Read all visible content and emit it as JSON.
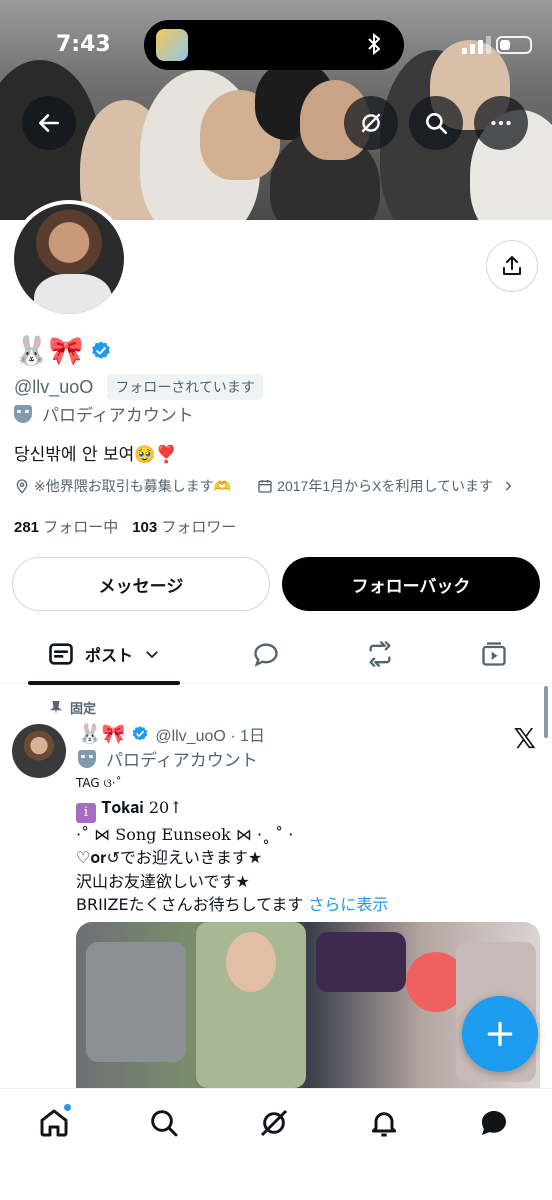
{
  "status_bar": {
    "time": "7:43"
  },
  "profile": {
    "name_emojis": "🐰🎀",
    "handle": "@llv_uoO",
    "follows_you": "フォローされています",
    "parody_label": "パロディアカウント",
    "bio": "당신밖에 안 보여🥹❣️",
    "location": "※他界隈お取引も募集します🫶",
    "joined": "2017年1月からXを利用しています",
    "following_count": "281",
    "following_label": "フォロー中",
    "followers_count": "103",
    "followers_label": "フォロワー"
  },
  "actions": {
    "message": "メッセージ",
    "follow_back": "フォローバック"
  },
  "tabs": {
    "posts": "ポスト"
  },
  "post": {
    "pinned": "固定",
    "name": "🐰🎀",
    "handle_time": "@llv_uoO · 1日",
    "parody_label": "パロディアカウント",
    "tag_line": "TAG ଓ·˚",
    "line2_badge": "i",
    "line2_text": "𝐓𝐨𝐤𝐚𝐢 20↑",
    "line3": "·˚ ⋈ Song Eunseok ⋈ ·˳ ˚ ·",
    "line4": "♡𝐨𝐫↺でお迎えいきます★",
    "line5": "沢山お友達欲しいです★",
    "line6": "BRIIZEたくさんお待ちしてます",
    "more": "さらに表示"
  },
  "icons": {
    "back": "back-arrow-icon",
    "grok": "grok-icon",
    "search": "search-icon",
    "more": "more-icon",
    "share": "share-icon",
    "fab": "compose-icon"
  },
  "colors": {
    "accent": "#1d9bf0",
    "text": "#0f1419",
    "muted": "#536471"
  }
}
